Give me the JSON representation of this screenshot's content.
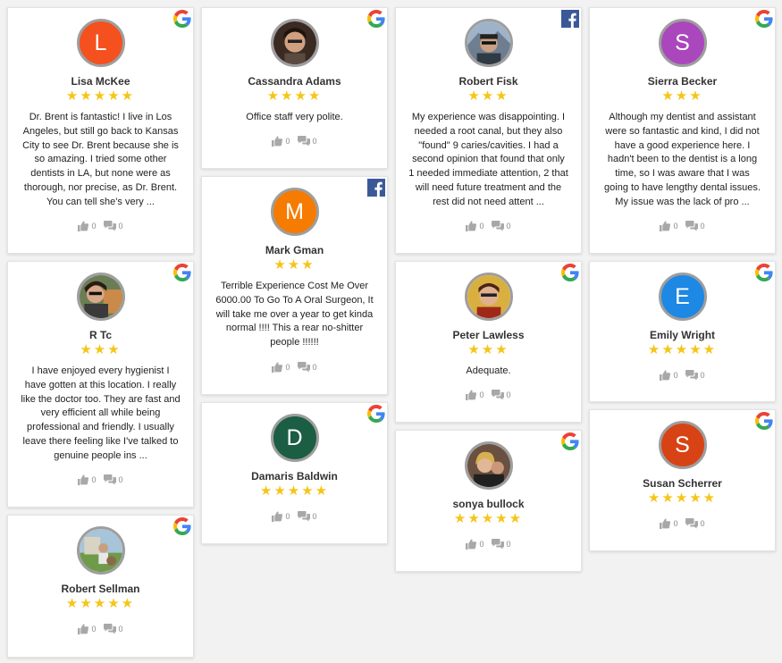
{
  "brand_colors": {
    "google_blue": "#4285F4",
    "facebook_blue": "#3B5998",
    "star": "#F5C518"
  },
  "reviews": [
    {
      "name": "Lisa McKee",
      "source": "google-icon",
      "rating": 5,
      "avatar_letter": "L",
      "avatar_color": "#F4511E",
      "text": "Dr. Brent is fantastic! I live in Los Angeles, but still go back to Kansas City to see Dr. Brent because she is so amazing. I tried some other dentists in LA, but none were as thorough, nor precise, as Dr. Brent. You can tell she's very ...",
      "likes": "0",
      "comments": "0"
    },
    {
      "name": "Cassandra Adams",
      "source": "google-icon",
      "rating": 4,
      "avatar_letter": "",
      "avatar_color": "#7a4e3a",
      "text": "Office staff very polite.",
      "likes": "0",
      "comments": "0"
    },
    {
      "name": "Robert Fisk",
      "source": "facebook-icon",
      "rating": 3,
      "avatar_letter": "",
      "avatar_color": "#6d7a86",
      "text": "My experience was disappointing. I needed a root canal, but they also \"found\" 9 caries/cavities. I had a second opinion that found that only 1 needed immediate attention, 2 that will need future treatment and the rest did not need attent ...",
      "likes": "0",
      "comments": "0"
    },
    {
      "name": "Sierra Becker",
      "source": "google-icon",
      "rating": 3,
      "avatar_letter": "S",
      "avatar_color": "#AB47BC",
      "text": "Although my dentist and assistant were so fantastic and kind, I did not have a good experience here. I hadn't been to the dentist is a long time, so I was aware that I was going to have lengthy dental issues. My issue was the lack of pro ...",
      "likes": "0",
      "comments": "0"
    },
    {
      "name": "Mark Gman",
      "source": "facebook-icon",
      "rating": 3,
      "avatar_letter": "M",
      "avatar_color": "#F57C00",
      "text": "Terrible Experience Cost Me Over 6000.00 To Go To A Oral Surgeon, It will take me over a year to get kinda normal !!!! This a rear no-shitter people !!!!!!",
      "likes": "0",
      "comments": "0"
    },
    {
      "name": "R Tc",
      "source": "google-icon",
      "rating": 3,
      "avatar_letter": "",
      "avatar_color": "#8a6a4a",
      "text": "I have enjoyed every hygienist I have gotten at this location. I really like the doctor too. They are fast and very efficient all while being professional and friendly. I usually leave there feeling like I've talked to genuine people ins ...",
      "likes": "0",
      "comments": "0"
    },
    {
      "name": "Peter Lawless",
      "source": "google-icon",
      "rating": 3,
      "avatar_letter": "",
      "avatar_color": "#b0402a",
      "text": "Adequate.",
      "likes": "0",
      "comments": "0"
    },
    {
      "name": "Emily Wright",
      "source": "google-icon",
      "rating": 5,
      "avatar_letter": "E",
      "avatar_color": "#1E88E5",
      "text": "",
      "likes": "0",
      "comments": "0"
    },
    {
      "name": "Damaris Baldwin",
      "source": "google-icon",
      "rating": 5,
      "avatar_letter": "D",
      "avatar_color": "#1B5E43",
      "text": "",
      "likes": "0",
      "comments": "0"
    },
    {
      "name": "sonya bullock",
      "source": "google-icon",
      "rating": 5,
      "avatar_letter": "",
      "avatar_color": "#9a7a5a",
      "text": "",
      "likes": "0",
      "comments": "0"
    },
    {
      "name": "Susan Scherrer",
      "source": "google-icon",
      "rating": 5,
      "avatar_letter": "S",
      "avatar_color": "#D84315",
      "text": "",
      "likes": "0",
      "comments": "0"
    },
    {
      "name": "Robert Sellman",
      "source": "google-icon",
      "rating": 5,
      "avatar_letter": "",
      "avatar_color": "#7a8a6a",
      "text": "",
      "likes": "0",
      "comments": "0"
    }
  ]
}
